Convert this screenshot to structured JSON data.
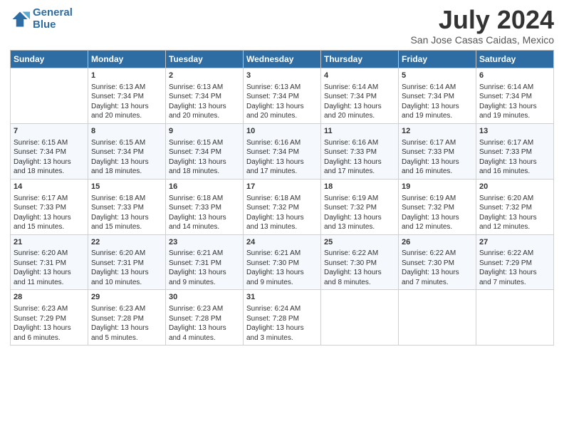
{
  "logo": {
    "line1": "General",
    "line2": "Blue"
  },
  "title": "July 2024",
  "subtitle": "San Jose Casas Caidas, Mexico",
  "columns": [
    "Sunday",
    "Monday",
    "Tuesday",
    "Wednesday",
    "Thursday",
    "Friday",
    "Saturday"
  ],
  "weeks": [
    [
      {
        "day": "",
        "text": ""
      },
      {
        "day": "1",
        "text": "Sunrise: 6:13 AM\nSunset: 7:34 PM\nDaylight: 13 hours\nand 20 minutes."
      },
      {
        "day": "2",
        "text": "Sunrise: 6:13 AM\nSunset: 7:34 PM\nDaylight: 13 hours\nand 20 minutes."
      },
      {
        "day": "3",
        "text": "Sunrise: 6:13 AM\nSunset: 7:34 PM\nDaylight: 13 hours\nand 20 minutes."
      },
      {
        "day": "4",
        "text": "Sunrise: 6:14 AM\nSunset: 7:34 PM\nDaylight: 13 hours\nand 20 minutes."
      },
      {
        "day": "5",
        "text": "Sunrise: 6:14 AM\nSunset: 7:34 PM\nDaylight: 13 hours\nand 19 minutes."
      },
      {
        "day": "6",
        "text": "Sunrise: 6:14 AM\nSunset: 7:34 PM\nDaylight: 13 hours\nand 19 minutes."
      }
    ],
    [
      {
        "day": "7",
        "text": "Sunrise: 6:15 AM\nSunset: 7:34 PM\nDaylight: 13 hours\nand 18 minutes."
      },
      {
        "day": "8",
        "text": "Sunrise: 6:15 AM\nSunset: 7:34 PM\nDaylight: 13 hours\nand 18 minutes."
      },
      {
        "day": "9",
        "text": "Sunrise: 6:15 AM\nSunset: 7:34 PM\nDaylight: 13 hours\nand 18 minutes."
      },
      {
        "day": "10",
        "text": "Sunrise: 6:16 AM\nSunset: 7:34 PM\nDaylight: 13 hours\nand 17 minutes."
      },
      {
        "day": "11",
        "text": "Sunrise: 6:16 AM\nSunset: 7:33 PM\nDaylight: 13 hours\nand 17 minutes."
      },
      {
        "day": "12",
        "text": "Sunrise: 6:17 AM\nSunset: 7:33 PM\nDaylight: 13 hours\nand 16 minutes."
      },
      {
        "day": "13",
        "text": "Sunrise: 6:17 AM\nSunset: 7:33 PM\nDaylight: 13 hours\nand 16 minutes."
      }
    ],
    [
      {
        "day": "14",
        "text": "Sunrise: 6:17 AM\nSunset: 7:33 PM\nDaylight: 13 hours\nand 15 minutes."
      },
      {
        "day": "15",
        "text": "Sunrise: 6:18 AM\nSunset: 7:33 PM\nDaylight: 13 hours\nand 15 minutes."
      },
      {
        "day": "16",
        "text": "Sunrise: 6:18 AM\nSunset: 7:33 PM\nDaylight: 13 hours\nand 14 minutes."
      },
      {
        "day": "17",
        "text": "Sunrise: 6:18 AM\nSunset: 7:32 PM\nDaylight: 13 hours\nand 13 minutes."
      },
      {
        "day": "18",
        "text": "Sunrise: 6:19 AM\nSunset: 7:32 PM\nDaylight: 13 hours\nand 13 minutes."
      },
      {
        "day": "19",
        "text": "Sunrise: 6:19 AM\nSunset: 7:32 PM\nDaylight: 13 hours\nand 12 minutes."
      },
      {
        "day": "20",
        "text": "Sunrise: 6:20 AM\nSunset: 7:32 PM\nDaylight: 13 hours\nand 12 minutes."
      }
    ],
    [
      {
        "day": "21",
        "text": "Sunrise: 6:20 AM\nSunset: 7:31 PM\nDaylight: 13 hours\nand 11 minutes."
      },
      {
        "day": "22",
        "text": "Sunrise: 6:20 AM\nSunset: 7:31 PM\nDaylight: 13 hours\nand 10 minutes."
      },
      {
        "day": "23",
        "text": "Sunrise: 6:21 AM\nSunset: 7:31 PM\nDaylight: 13 hours\nand 9 minutes."
      },
      {
        "day": "24",
        "text": "Sunrise: 6:21 AM\nSunset: 7:30 PM\nDaylight: 13 hours\nand 9 minutes."
      },
      {
        "day": "25",
        "text": "Sunrise: 6:22 AM\nSunset: 7:30 PM\nDaylight: 13 hours\nand 8 minutes."
      },
      {
        "day": "26",
        "text": "Sunrise: 6:22 AM\nSunset: 7:30 PM\nDaylight: 13 hours\nand 7 minutes."
      },
      {
        "day": "27",
        "text": "Sunrise: 6:22 AM\nSunset: 7:29 PM\nDaylight: 13 hours\nand 7 minutes."
      }
    ],
    [
      {
        "day": "28",
        "text": "Sunrise: 6:23 AM\nSunset: 7:29 PM\nDaylight: 13 hours\nand 6 minutes."
      },
      {
        "day": "29",
        "text": "Sunrise: 6:23 AM\nSunset: 7:28 PM\nDaylight: 13 hours\nand 5 minutes."
      },
      {
        "day": "30",
        "text": "Sunrise: 6:23 AM\nSunset: 7:28 PM\nDaylight: 13 hours\nand 4 minutes."
      },
      {
        "day": "31",
        "text": "Sunrise: 6:24 AM\nSunset: 7:28 PM\nDaylight: 13 hours\nand 3 minutes."
      },
      {
        "day": "",
        "text": ""
      },
      {
        "day": "",
        "text": ""
      },
      {
        "day": "",
        "text": ""
      }
    ]
  ]
}
